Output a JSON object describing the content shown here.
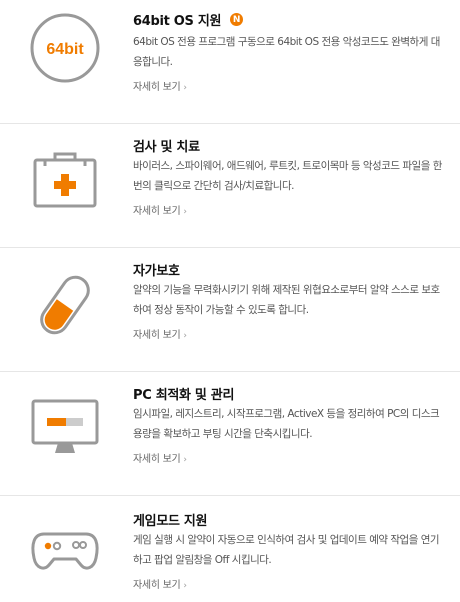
{
  "features": [
    {
      "title": "64bit OS 지원",
      "badge": "N",
      "icon_text": "64bit",
      "description": "64bit OS 전용 프로그램 구동으로 64bit OS 전용 악성코드도 완벽하게 대응합니다.",
      "more_label": "자세히 보기",
      "more_arrow": "›"
    },
    {
      "title": "검사 및 치료",
      "description": "바이러스, 스파이웨어, 애드웨어, 루트킷, 트로이목마 등 악성코드 파일을 한번의 클릭으로 간단히 검사/치료합니다.",
      "more_label": "자세히 보기",
      "more_arrow": "›"
    },
    {
      "title": "자가보호",
      "description": "알약의 기능을 무력화시키기 위해 제작된 위협요소로부터 알약 스스로 보호하여 정상 동작이 가능할 수 있도록 합니다.",
      "more_label": "자세히 보기",
      "more_arrow": "›"
    },
    {
      "title": "PC 최적화 및 관리",
      "description": "임시파일, 레지스트리, 시작프로그램, ActiveX 등을 정리하여 PC의 디스크 용량을 확보하고 부팅 시간을 단축시킵니다.",
      "more_label": "자세히 보기",
      "more_arrow": "›"
    },
    {
      "title": "게임모드 지원",
      "description": "게임 실행 시 알약이 자동으로 인식하여 검사 및 업데이트 예약 작업을 연기하고 팝업 알림창을 Off 시킵니다.",
      "more_label": "자세히 보기",
      "more_arrow": "›"
    }
  ],
  "colors": {
    "accent": "#f07c00",
    "icon_gray": "#999999",
    "divider": "#e6e6e6"
  },
  "icons": [
    "64bit-circle-icon",
    "first-aid-kit-icon",
    "pill-capsule-icon",
    "monitor-optimize-icon",
    "gamepad-icon"
  ]
}
